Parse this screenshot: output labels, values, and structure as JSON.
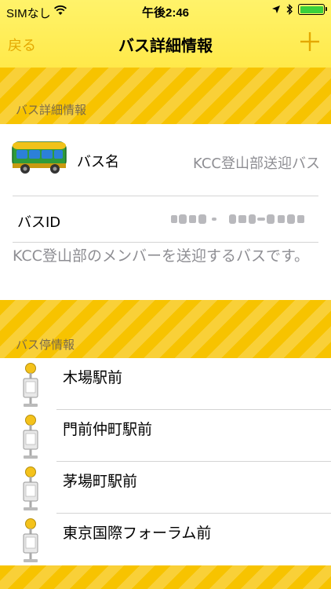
{
  "status_bar": {
    "carrier": "SIMなし",
    "time": "午後2:46"
  },
  "nav": {
    "back_label": "戻る",
    "title": "バス詳細情報",
    "add_icon": "plus-icon"
  },
  "sections": {
    "bus_detail_header": "バス詳細情報",
    "bus_stops_header": "バス停情報"
  },
  "bus": {
    "name_label": "バス名",
    "name_value": "KCC登山部送迎バス",
    "id_label": "バスID",
    "description": "KCC登山部のメンバーを送迎するバスです。"
  },
  "stops": [
    {
      "name": "木場駅前"
    },
    {
      "name": "門前仲町駅前"
    },
    {
      "name": "茅場町駅前"
    },
    {
      "name": "東京国際フォーラム前"
    }
  ],
  "colors": {
    "accent": "#f7c300",
    "nav_tint": "#e4a800",
    "secondary_text": "#8e8e93",
    "battery": "#3bd13b"
  }
}
